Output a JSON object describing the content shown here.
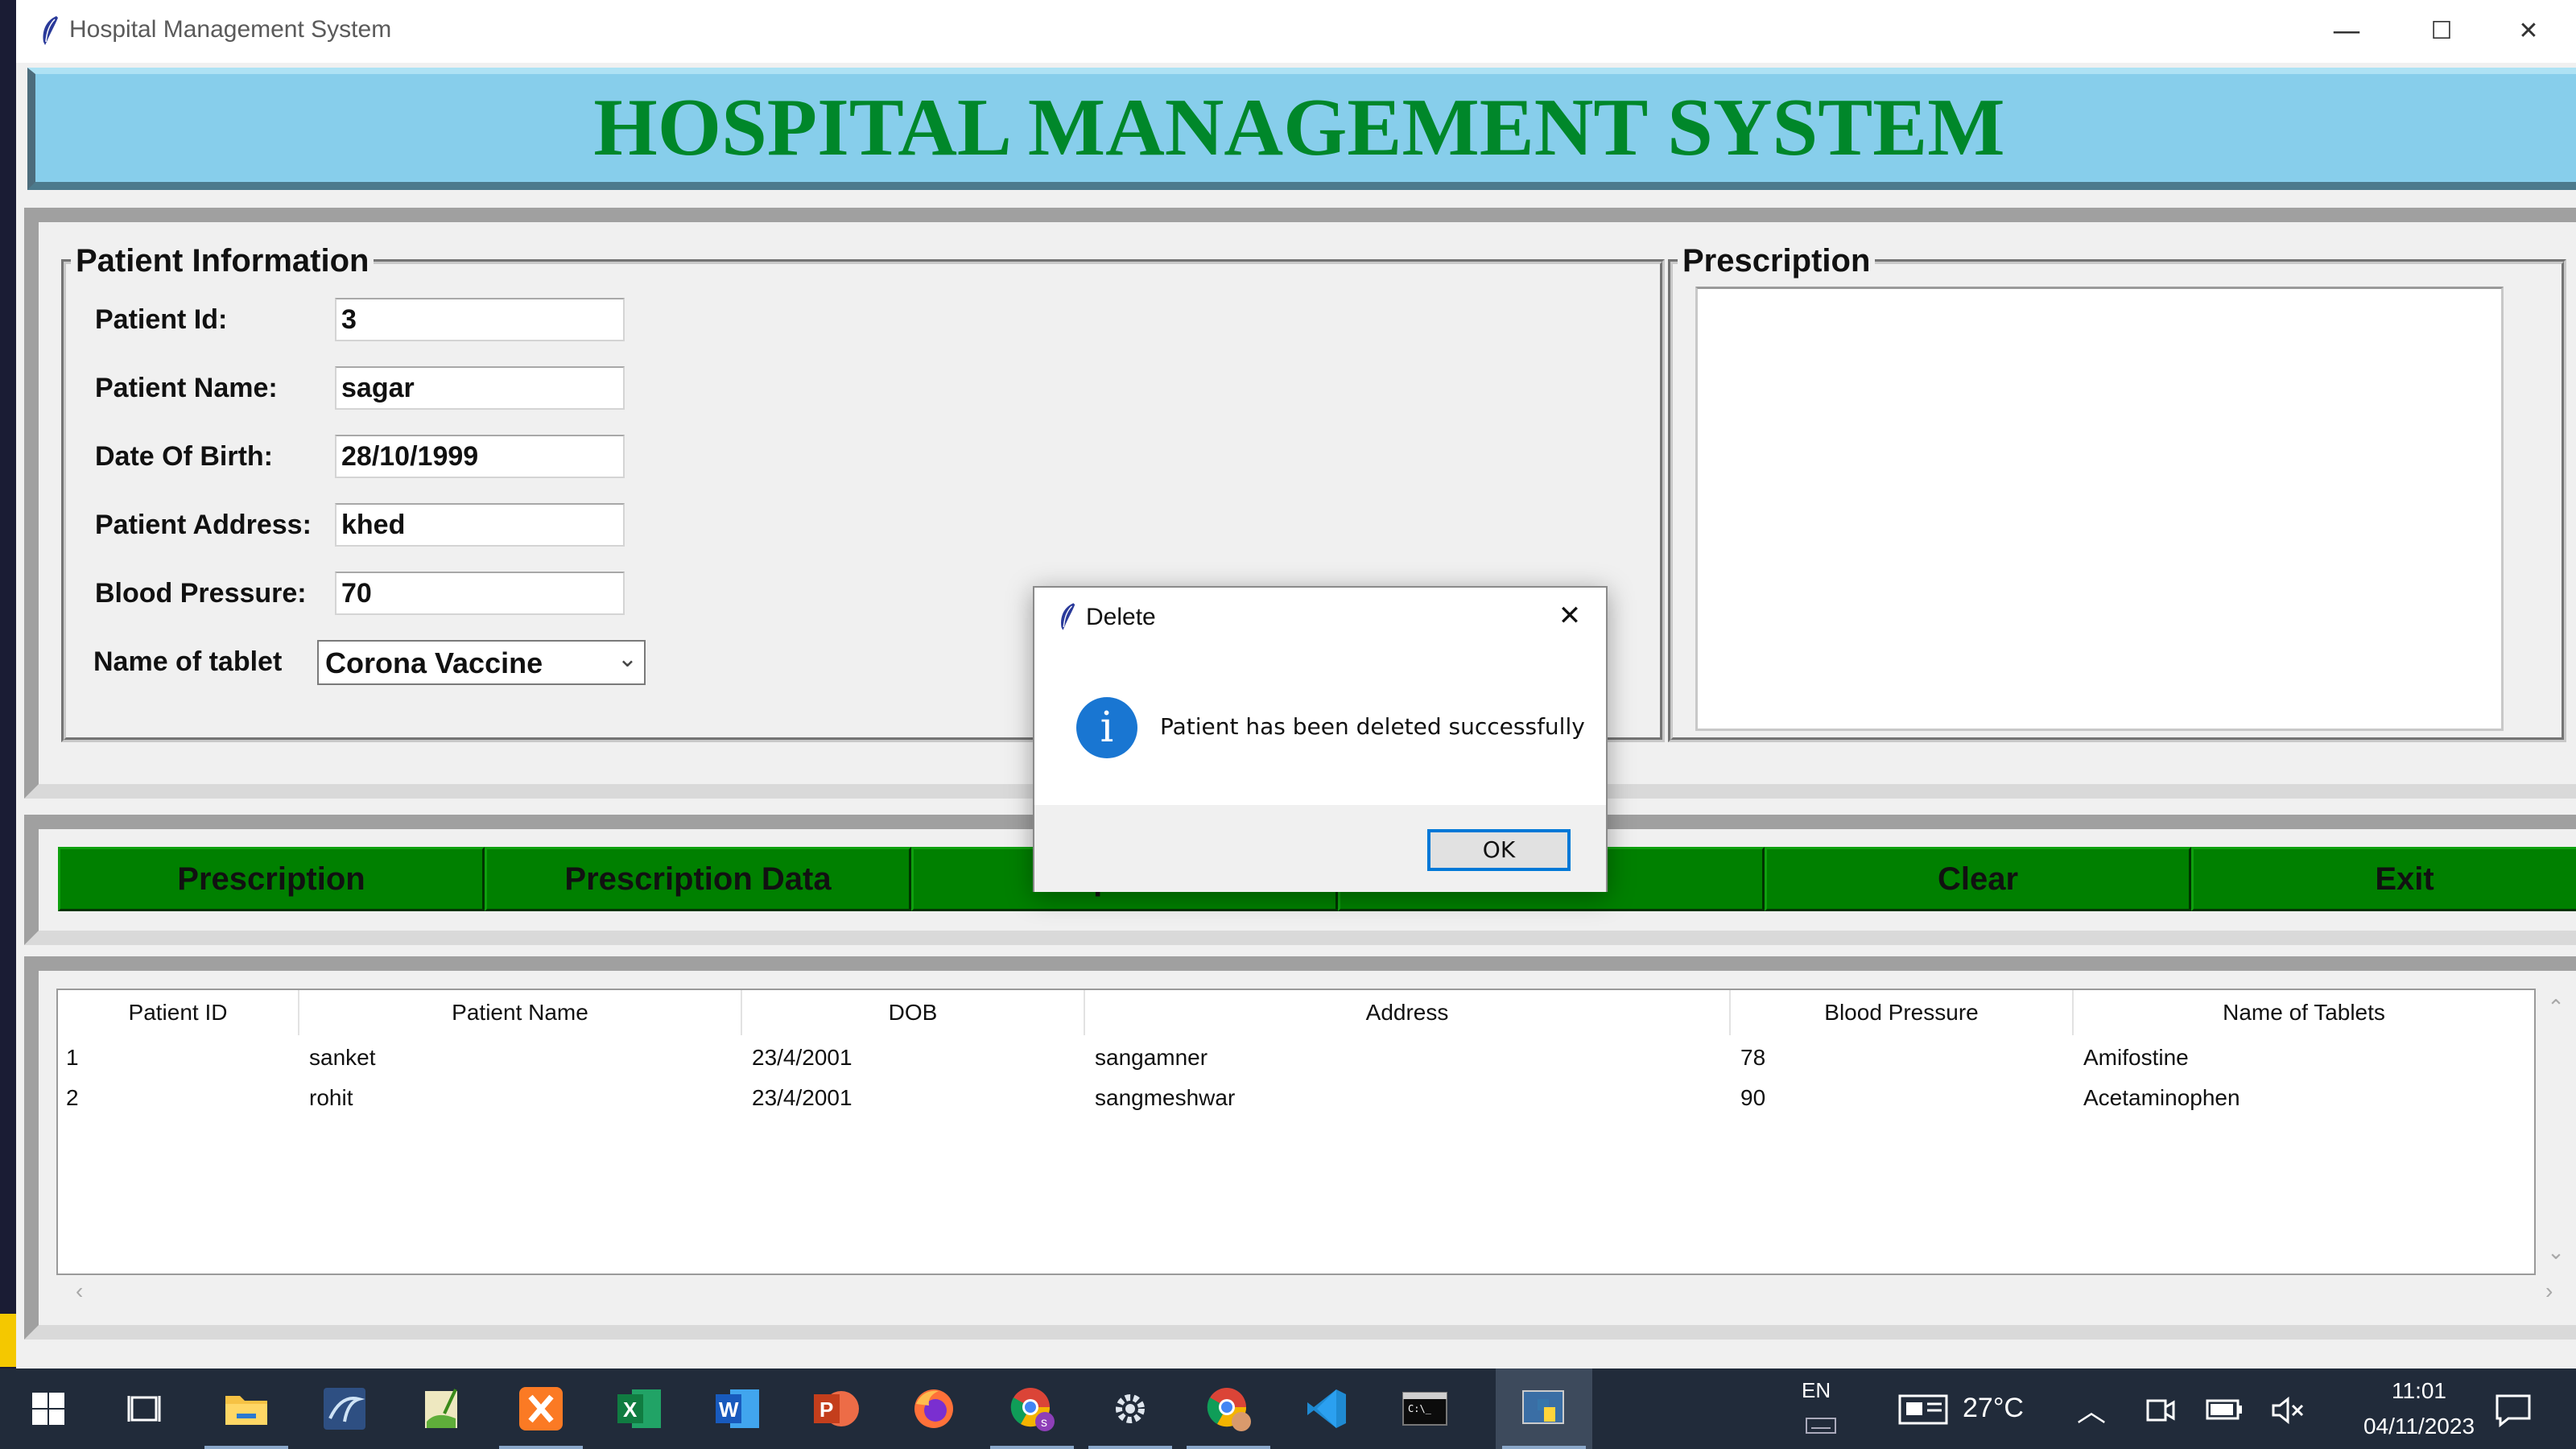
{
  "window": {
    "title": "Hospital Management System",
    "minimize": "—",
    "maximize": "☐",
    "close": "✕"
  },
  "banner": {
    "heading": "HOSPITAL MANAGEMENT SYSTEM"
  },
  "patient_info": {
    "group_label": "Patient Information",
    "fields": [
      {
        "label": "Patient Id:",
        "value": "3"
      },
      {
        "label": "Patient Name:",
        "value": "sagar"
      },
      {
        "label": "Date Of Birth:",
        "value": "28/10/1999"
      },
      {
        "label": "Patient Address:",
        "value": "khed"
      },
      {
        "label": "Blood Pressure:",
        "value": "70"
      }
    ],
    "tablet_label": "Name of tablet",
    "tablet_value": "Corona Vaccine"
  },
  "prescription": {
    "group_label": "Prescription"
  },
  "buttons": [
    {
      "label": "Prescription"
    },
    {
      "label": "Prescription Data"
    },
    {
      "label": "Update"
    },
    {
      "label": "Delete"
    },
    {
      "label": "Clear"
    },
    {
      "label": "Exit"
    }
  ],
  "table": {
    "columns": [
      "Patient ID",
      "Patient Name",
      "DOB",
      "Address",
      "Blood Pressure",
      "Name of Tablets"
    ],
    "rows": [
      [
        "1",
        "sanket",
        "23/4/2001",
        "sangamner",
        "78",
        "Amifostine"
      ],
      [
        "2",
        "rohit",
        "23/4/2001",
        "sangmeshwar",
        "90",
        "Acetaminophen"
      ]
    ]
  },
  "dialog": {
    "title": "Delete",
    "message": "Patient has been deleted successfully",
    "ok_label": "OK",
    "close": "✕",
    "icon": "info-icon"
  },
  "taskbar": {
    "apps": [
      "windows-start-icon",
      "task-view-icon",
      "file-explorer-icon",
      "mysql-workbench-icon",
      "notepad-plus-plus-icon",
      "xampp-icon",
      "excel-icon",
      "word-icon",
      "powerpoint-icon",
      "firefox-icon",
      "chrome-profile-icon",
      "settings-icon",
      "chrome-icon",
      "vscode-icon",
      "terminal-icon",
      "python-idle-icon"
    ],
    "language": "EN",
    "temperature": "27°C",
    "time": "11:01",
    "date": "04/11/2023"
  },
  "colors": {
    "banner_bg": "#87ceeb",
    "heading": "#00872a",
    "button_bg": "#008000",
    "dialog_info": "#1976d2"
  }
}
